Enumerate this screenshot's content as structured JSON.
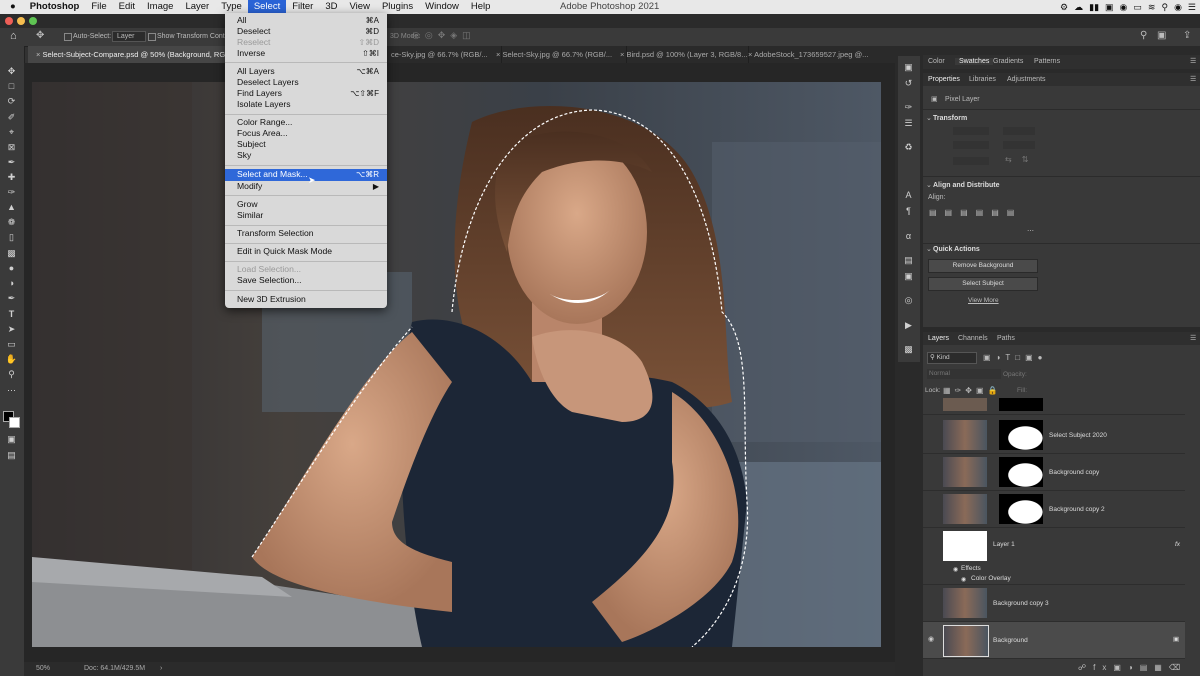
{
  "menubar": {
    "apple": "",
    "items": [
      "Photoshop",
      "File",
      "Edit",
      "Image",
      "Layer",
      "Type",
      "Select",
      "Filter",
      "3D",
      "View",
      "Plugins",
      "Window",
      "Help"
    ],
    "active": "Select",
    "app_title": "Adobe Photoshop 2021"
  },
  "options": {
    "auto_select": "Auto-Select:",
    "layer_select": "Layer",
    "show_transform": "Show Transform Controls",
    "mode3d": "3D Mode:"
  },
  "tabs": [
    "Select-Subject-Compare.psd @ 50% (Background, RGB/8) *",
    "ce-Sky.jpg @ 66.7% (RGB/...",
    "Select-Sky.jpg @ 66.7% (RGB/...",
    "Bird.psd @ 100% (Layer 3, RGB/8...",
    "AdobeStock_173659527.jpeg @..."
  ],
  "select_menu": [
    {
      "label": "All",
      "key": "⌘A",
      "enabled": true
    },
    {
      "label": "Deselect",
      "key": "⌘D",
      "enabled": true
    },
    {
      "label": "Reselect",
      "key": "⇧⌘D",
      "enabled": false
    },
    {
      "label": "Inverse",
      "key": "⇧⌘I",
      "enabled": true
    },
    {
      "label": "All Layers",
      "key": "⌥⌘A",
      "enabled": true
    },
    {
      "label": "Deselect Layers",
      "key": "",
      "enabled": true
    },
    {
      "label": "Find Layers",
      "key": "⌥⇧⌘F",
      "enabled": true
    },
    {
      "label": "Isolate Layers",
      "key": "",
      "enabled": true
    },
    {
      "label": "Color Range...",
      "key": "",
      "enabled": true
    },
    {
      "label": "Focus Area...",
      "key": "",
      "enabled": true
    },
    {
      "label": "Subject",
      "key": "",
      "enabled": true
    },
    {
      "label": "Sky",
      "key": "",
      "enabled": true
    },
    {
      "label": "Select and Mask...",
      "key": "⌥⌘R",
      "enabled": true,
      "highlighted": true
    },
    {
      "label": "Modify",
      "key": "▶",
      "enabled": true
    },
    {
      "label": "Grow",
      "key": "",
      "enabled": true
    },
    {
      "label": "Similar",
      "key": "",
      "enabled": true
    },
    {
      "label": "Transform Selection",
      "key": "",
      "enabled": true
    },
    {
      "label": "Edit in Quick Mask Mode",
      "key": "",
      "enabled": true
    },
    {
      "label": "Load Selection...",
      "key": "",
      "enabled": false
    },
    {
      "label": "Save Selection...",
      "key": "",
      "enabled": true
    },
    {
      "label": "New 3D Extrusion",
      "key": "",
      "enabled": true
    }
  ],
  "panel_tabs_top": [
    "Color",
    "Swatches",
    "Gradients",
    "Patterns"
  ],
  "properties": {
    "tabs": [
      "Properties",
      "Libraries",
      "Adjustments"
    ],
    "kind": "Pixel Layer",
    "transform": "Transform",
    "align_distribute": "Align and Distribute",
    "align": "Align:",
    "quick_actions": "Quick Actions",
    "remove_bg": "Remove Background",
    "select_subject": "Select Subject",
    "view_more": "View More"
  },
  "layers_panel": {
    "tabs": [
      "Layers",
      "Channels",
      "Paths"
    ],
    "filter": "Kind",
    "blend": "Normal",
    "opacity": "Opacity:",
    "lock": "Lock:",
    "fill": "Fill:",
    "layers": [
      "Select Subject 2020",
      "Background copy",
      "Background copy 2",
      "Layer 1",
      "Background copy 3",
      "Background"
    ],
    "effects": "Effects",
    "color_overlay": "Color Overlay"
  },
  "status": {
    "zoom": "50%",
    "doc": "Doc: 64.1M/429.5M"
  },
  "colors": {
    "menu_highlight": "#2f68d9",
    "active_menu": "#2a63d6"
  }
}
